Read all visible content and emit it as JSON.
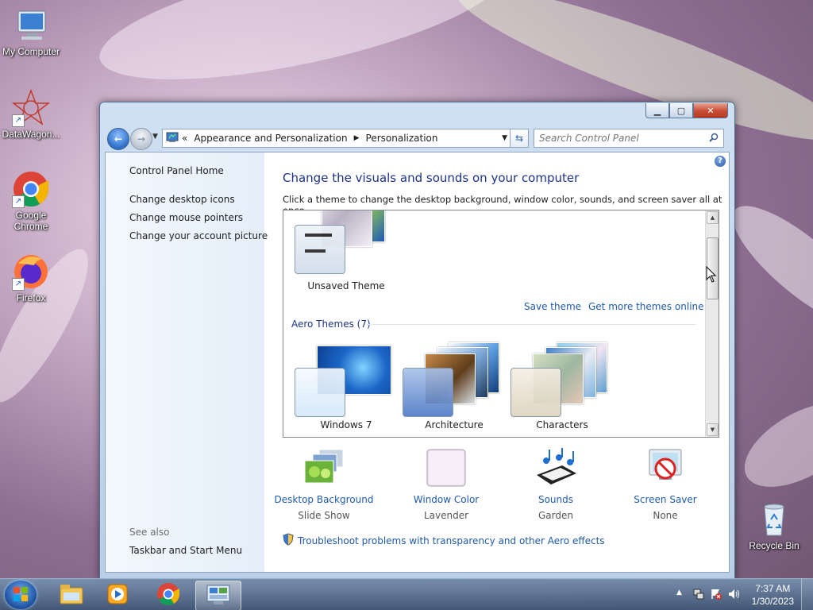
{
  "desktop": {
    "icons": [
      {
        "label": "My Computer",
        "icon": "computer-icon"
      },
      {
        "label": "DataWagon...",
        "icon": "datawagon-icon"
      },
      {
        "label": "Google Chrome",
        "icon": "chrome-icon"
      },
      {
        "label": "Firefox",
        "icon": "firefox-icon"
      },
      {
        "label": "Recycle Bin",
        "icon": "recycle-bin-icon"
      }
    ]
  },
  "window": {
    "breadcrumb": {
      "chevrons": "«",
      "part1": "Appearance and Personalization",
      "part2": "Personalization"
    },
    "search_placeholder": "Search Control Panel",
    "left_pane": {
      "home": "Control Panel Home",
      "links": [
        "Change desktop icons",
        "Change mouse pointers",
        "Change your account picture"
      ],
      "see_also_label": "See also",
      "see_also_links": [
        "Taskbar and Start Menu"
      ]
    },
    "main": {
      "title": "Change the visuals and sounds on your computer",
      "subtitle": "Click a theme to change the desktop background, window color, sounds, and screen saver all at once.",
      "unsaved_theme": "Unsaved Theme",
      "save_theme": "Save theme",
      "get_more": "Get more themes online",
      "aero_header": "Aero Themes (7)",
      "themes": [
        "Windows 7",
        "Architecture",
        "Characters"
      ],
      "bottom": [
        {
          "label": "Desktop Background",
          "value": "Slide Show",
          "icon": "desktop-background-icon"
        },
        {
          "label": "Window Color",
          "value": "Lavender",
          "icon": "window-color-icon"
        },
        {
          "label": "Sounds",
          "value": "Garden",
          "icon": "sounds-icon"
        },
        {
          "label": "Screen Saver",
          "value": "None",
          "icon": "screen-saver-icon"
        }
      ],
      "troubleshoot": "Troubleshoot problems with transparency and other Aero effects"
    }
  },
  "taskbar": {
    "time": "7:37 AM",
    "date": "1/30/2023",
    "buttons": [
      "explorer-icon",
      "media-player-icon",
      "chrome-icon",
      "control-panel-icon"
    ]
  }
}
